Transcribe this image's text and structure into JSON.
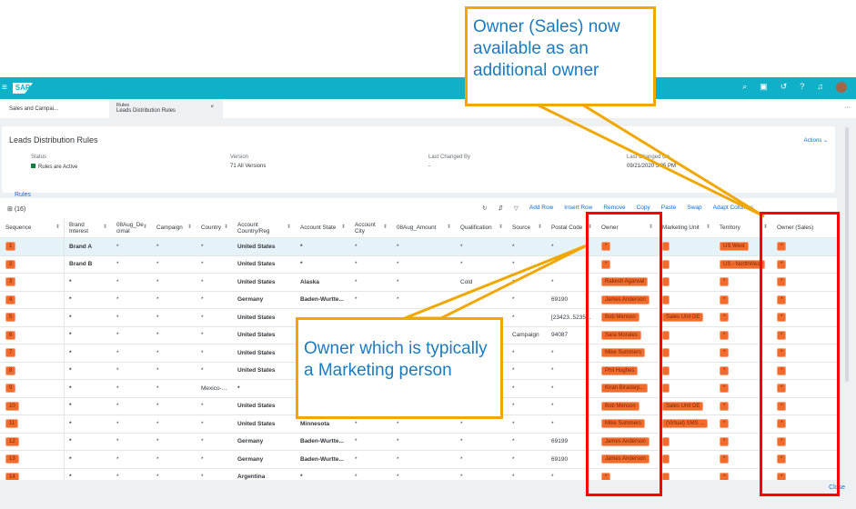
{
  "shell": {
    "logo": "SAP",
    "icons": [
      "search-icon",
      "feedback-icon",
      "history-icon",
      "help-icon",
      "notification-icon"
    ]
  },
  "tabs": [
    {
      "label": "Sales and Campai..."
    },
    {
      "label": "Rules",
      "sublabel": "Leads Distribution Rules",
      "close": "×"
    }
  ],
  "more": "···",
  "header": {
    "title": "Leads Distribution Rules",
    "actions": "Actions ⌄",
    "status_label": "Status",
    "status_value": "Rules are Active",
    "status_color": "#107e3e",
    "version_label": "Version",
    "version_value": "71  All Versions",
    "changed_by_label": "Last Changed By",
    "changed_by_value": "-",
    "changed_on_label": "Last Changed On",
    "changed_on_value": "09/21/2020 5:35 PM",
    "tab": "Rules"
  },
  "table": {
    "count": "(16)",
    "toolbar": [
      "Add Row",
      "Insert Row",
      "Remove",
      "Copy",
      "Paste",
      "Swap",
      "Adapt Columns"
    ],
    "columns": [
      "Sequence",
      "Brand Interest",
      "08Aug_De cimal",
      "Campaign",
      "Country",
      "Account Country/Reg",
      "Account State",
      "Account City",
      "08Aug_Amount",
      "Qualification",
      "Source",
      "Postal Code",
      "Owner",
      "Marketing Unit",
      "Territory",
      "Owner (Sales)"
    ],
    "rows": [
      [
        "1",
        "Brand A",
        "*",
        "*",
        "*",
        "United States",
        "*",
        "*",
        "*",
        "*",
        "*",
        "*",
        "*",
        "",
        "US West",
        "*"
      ],
      [
        "2",
        "Brand B",
        "*",
        "*",
        "*",
        "United States",
        "*",
        "*",
        "*",
        "*",
        "*",
        "*",
        "*",
        "",
        "US - NorthWest",
        "*"
      ],
      [
        "3",
        "*",
        "*",
        "*",
        "*",
        "United States",
        "Alaska",
        "*",
        "*",
        "Cold",
        "*",
        "*",
        "Rakesh Agarwal",
        "",
        "*",
        "*"
      ],
      [
        "4",
        "*",
        "*",
        "*",
        "*",
        "Germany",
        "Baden-Wurtte...",
        "*",
        "*",
        "",
        "*",
        "69190",
        "James Anderson",
        "",
        "*",
        "*"
      ],
      [
        "5",
        "*",
        "*",
        "*",
        "*",
        "United States",
        "",
        "",
        "",
        "",
        "*",
        "[23423..5235...",
        "Bob Menson",
        "Sales Unit DE",
        "*",
        "*"
      ],
      [
        "6",
        "*",
        "*",
        "*",
        "*",
        "United States",
        "",
        "",
        "",
        "",
        "Campaign",
        "94087",
        "Sara Morales",
        "",
        "*",
        "*"
      ],
      [
        "7",
        "*",
        "*",
        "*",
        "*",
        "United States",
        "",
        "",
        "",
        "",
        "*",
        "*",
        "Mike Summers",
        "",
        "*",
        "*"
      ],
      [
        "8",
        "*",
        "*",
        "*",
        "*",
        "United States",
        "",
        "",
        "",
        "",
        "*",
        "*",
        "Phil Hughes",
        "",
        "*",
        "*"
      ],
      [
        "9",
        "*",
        "*",
        "*",
        "Mexico-...",
        "*",
        "",
        "",
        "",
        "",
        "*",
        "*",
        "Kiran Biradarp...",
        "",
        "*",
        "*"
      ],
      [
        "10",
        "*",
        "*",
        "*",
        "*",
        "United States",
        "",
        "",
        "",
        "",
        "*",
        "*",
        "Bob Menson",
        "Sales Unit DE",
        "*",
        "*"
      ],
      [
        "11",
        "*",
        "*",
        "*",
        "*",
        "United States",
        "Minnesota",
        "*",
        "*",
        "*",
        "*",
        "*",
        "Mike Summers",
        "(Virtual) SMS ...",
        "*",
        "*"
      ],
      [
        "12",
        "*",
        "*",
        "*",
        "*",
        "Germany",
        "Baden-Wurtte...",
        "*",
        "*",
        "*",
        "*",
        "69199",
        "James Anderson",
        "",
        "*",
        "*"
      ],
      [
        "13",
        "*",
        "*",
        "*",
        "*",
        "Germany",
        "Baden-Wurtte...",
        "*",
        "*",
        "*",
        "*",
        "69190",
        "James Anderson",
        "",
        "*",
        "*"
      ],
      [
        "14",
        "*",
        "*",
        "*",
        "*",
        "Argentina",
        "*",
        "*",
        "*",
        "*",
        "*",
        "*",
        "*",
        "",
        "*",
        "*"
      ]
    ],
    "close": "Close"
  },
  "callouts": {
    "top": "Owner (Sales) now available as an additional owner",
    "bottom": "Owner which is typically a Marketing person",
    "color": "#f0a800",
    "highlight": "#ff0000"
  }
}
